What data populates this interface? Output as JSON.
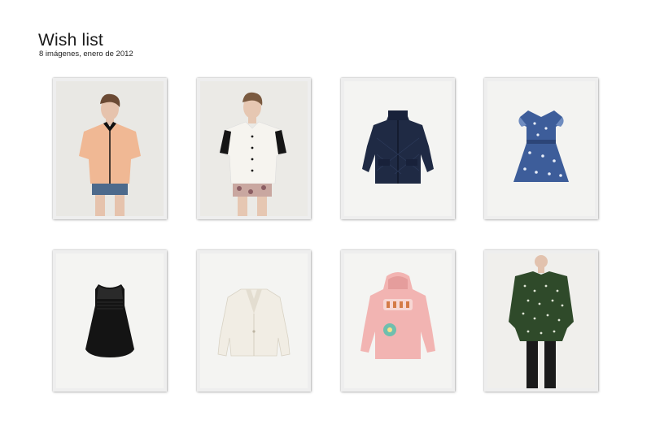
{
  "album": {
    "title": "Wish list",
    "subtitle": "8 imágenes, enero de 2012"
  },
  "photos": [
    {
      "subject": "peach short-sleeve shirt with black collar on model",
      "color": "#f0b894"
    },
    {
      "subject": "white short-sleeve blouse with black sleeve trim on model",
      "color": "#f2efe9"
    },
    {
      "subject": "navy quilted jacket",
      "color": "#1f2a44"
    },
    {
      "subject": "blue and white printed ruffle dress",
      "color": "#3d5d9a"
    },
    {
      "subject": "black sleeveless top with lace yoke",
      "color": "#1a1a1a"
    },
    {
      "subject": "white blazer",
      "color": "#f1ede4"
    },
    {
      "subject": "pink hooded sweatshirt with graphic print",
      "color": "#f2b4b2"
    },
    {
      "subject": "dark green polka dot sweater on model",
      "color": "#2f4a2a"
    }
  ]
}
